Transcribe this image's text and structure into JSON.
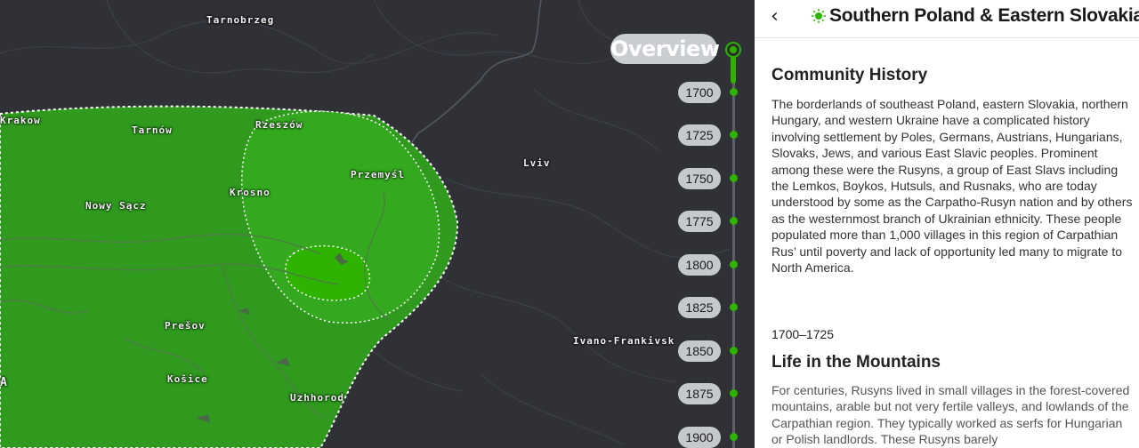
{
  "header": {
    "back_icon": "chevron-left-icon",
    "region_icon": "sun-icon",
    "region_title": "Southern Poland & Eastern Slovakia",
    "accent_color": "#2db300"
  },
  "map": {
    "cities": [
      {
        "name": "Tarnobrzeg"
      },
      {
        "name": "Krakow"
      },
      {
        "name": "Tarnów"
      },
      {
        "name": "Rzeszów"
      },
      {
        "name": "Przemyśl"
      },
      {
        "name": "Lviv"
      },
      {
        "name": "Krosno"
      },
      {
        "name": "Nowy Sącz"
      },
      {
        "name": "Prešov"
      },
      {
        "name": "Košice"
      },
      {
        "name": "Uzhhorod"
      },
      {
        "name": "Ivano-Frankivsk"
      },
      {
        "name": "A"
      }
    ]
  },
  "timeline": {
    "overview_label": "Overview",
    "years": [
      "1700",
      "1725",
      "1750",
      "1775",
      "1800",
      "1825",
      "1850",
      "1875",
      "1900"
    ]
  },
  "panel": {
    "section1": {
      "title": "Community History",
      "body": "The borderlands of southeast Poland, eastern Slovakia, northern Hungary, and western Ukraine have a complicated history involving settlement by Poles, Germans, Austrians, Hungarians, Slovaks, Jews, and various East Slavic peoples. Prominent among these were the Rusyns, a group of East Slavs including the Lemkos, Boykos, Hutsuls, and Rusnaks, who are today understood by some as the Carpatho-Rusyn nation and by others as the westernmost branch of Ukrainian ethnicity. These people populated more than 1,000 villages in this region of Carpathian Rus’ until poverty and lack of opportunity led many to migrate to North America."
    },
    "section2": {
      "date": "1700–1725",
      "title": "Life in the Mountains",
      "body": "For centuries, Rusyns lived in small villages in the forest-covered mountains, arable but not very fertile valleys, and lowlands of the Carpathian region. They typically worked as serfs for Hungarian or Polish landlords. These Rusyns barely"
    }
  }
}
